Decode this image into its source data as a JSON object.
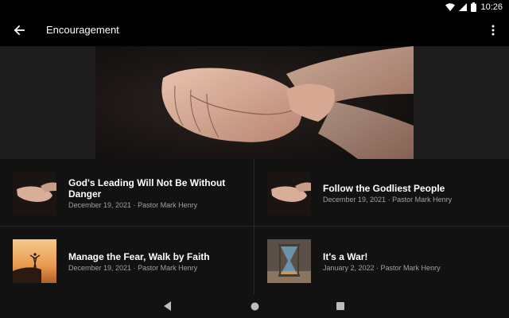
{
  "status_bar": {
    "time": "10:26"
  },
  "app_bar": {
    "title": "Encouragement"
  },
  "items": [
    {
      "title": "God's Leading Will Not Be Without Danger",
      "date": "December 19, 2021",
      "author": "Pastor Mark Henry",
      "thumb": "hands"
    },
    {
      "title": "Follow the Godliest People",
      "date": "December 19, 2021",
      "author": "Pastor Mark Henry",
      "thumb": "hands"
    },
    {
      "title": "Manage the Fear, Walk by Faith",
      "date": "December 19, 2021",
      "author": "Pastor Mark Henry",
      "thumb": "sunset-cliff"
    },
    {
      "title": "It's a War!",
      "date": "January 2, 2022",
      "author": "Pastor Mark Henry",
      "thumb": "hourglass"
    }
  ],
  "meta_separator": " · ",
  "colors": {
    "background": "#121212",
    "bar": "#000000",
    "meta_text": "#a0a0a0",
    "hero_side": "#1c1c1c"
  }
}
